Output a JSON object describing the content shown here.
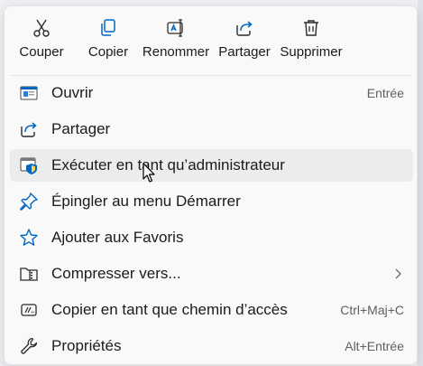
{
  "toolbar": {
    "cut": {
      "label": "Couper",
      "icon": "scissors-icon"
    },
    "copy": {
      "label": "Copier",
      "icon": "copy-icon"
    },
    "rename": {
      "label": "Renommer",
      "icon": "rename-icon"
    },
    "share": {
      "label": "Partager",
      "icon": "share-icon"
    },
    "delete": {
      "label": "Supprimer",
      "icon": "trash-icon"
    }
  },
  "menu_items": [
    {
      "label": "Ouvrir",
      "shortcut": "Entrée",
      "icon": "open-window-icon"
    },
    {
      "label": "Partager",
      "shortcut": "",
      "icon": "share-icon"
    },
    {
      "label": "Exécuter en tant qu’administrateur",
      "shortcut": "",
      "icon": "admin-shield-icon",
      "hovered": true
    },
    {
      "label": "Épingler au menu Démarrer",
      "shortcut": "",
      "icon": "pin-icon"
    },
    {
      "label": "Ajouter aux Favoris",
      "shortcut": "",
      "icon": "star-icon"
    },
    {
      "label": "Compresser vers...",
      "shortcut": "",
      "icon": "zip-folder-icon",
      "submenu": true
    },
    {
      "label": "Copier en tant que chemin d’accès",
      "shortcut": "Ctrl+Maj+C",
      "icon": "copy-path-icon"
    },
    {
      "label": "Propriétés",
      "shortcut": "Alt+Entrée",
      "icon": "wrench-icon"
    }
  ],
  "colors": {
    "accent": "#0067c0",
    "menu_bg": "#f9f9f9",
    "hover_bg": "#ececec"
  }
}
